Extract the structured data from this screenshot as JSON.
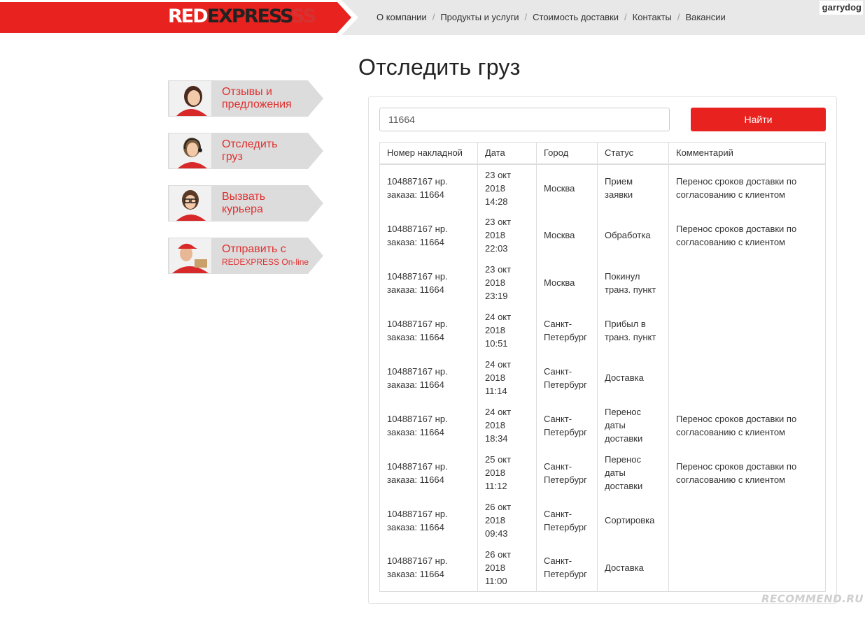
{
  "header": {
    "logo": {
      "red": "RED",
      "dark": "EXPRESS",
      "mark": "S"
    },
    "nav": [
      "О компании",
      "Продукты и услуги",
      "Стоимость доставки",
      "Контакты",
      "Вакансии"
    ],
    "user": "garrydog"
  },
  "page_title": "Отследить груз",
  "sidebar": {
    "items": [
      {
        "line1": "Отзывы и",
        "line2": "предложения",
        "avatar": "woman-smiling-icon"
      },
      {
        "line1": "Отследить",
        "line2": "груз",
        "avatar": "operator-headset-icon"
      },
      {
        "line1": "Вызвать",
        "line2": "курьера",
        "avatar": "woman-glasses-icon"
      },
      {
        "line1": "Отправить с",
        "line2": "REDEXPRESS On-line",
        "avatar": "courier-cap-icon"
      }
    ]
  },
  "search": {
    "value": "11664",
    "button": "Найти"
  },
  "table": {
    "headers": [
      "Номер накладной",
      "Дата",
      "Город",
      "Статус",
      "Комментарий"
    ],
    "rows": [
      {
        "waybill": [
          "104887167 нр.",
          "заказа: 11664"
        ],
        "date": [
          "23 окт",
          "2018",
          "14:28"
        ],
        "city": [
          "Москва"
        ],
        "status": [
          "Прием",
          "заявки"
        ],
        "comment": [
          "Перенос сроков доставки по",
          "согласованию с клиентом"
        ]
      },
      {
        "waybill": [
          "104887167 нр.",
          "заказа: 11664"
        ],
        "date": [
          "23 окт",
          "2018",
          "22:03"
        ],
        "city": [
          "Москва"
        ],
        "status": [
          "Обработка"
        ],
        "comment": [
          "Перенос сроков доставки по",
          "согласованию с клиентом"
        ]
      },
      {
        "waybill": [
          "104887167 нр.",
          "заказа: 11664"
        ],
        "date": [
          "23 окт",
          "2018",
          "23:19"
        ],
        "city": [
          "Москва"
        ],
        "status": [
          "Покинул",
          "транз. пункт"
        ],
        "comment": []
      },
      {
        "waybill": [
          "104887167 нр.",
          "заказа: 11664"
        ],
        "date": [
          "24 окт",
          "2018",
          "10:51"
        ],
        "city": [
          "Санкт-",
          "Петербург"
        ],
        "status": [
          "Прибыл в",
          "транз. пункт"
        ],
        "comment": []
      },
      {
        "waybill": [
          "104887167 нр.",
          "заказа: 11664"
        ],
        "date": [
          "24 окт",
          "2018",
          "11:14"
        ],
        "city": [
          "Санкт-",
          "Петербург"
        ],
        "status": [
          "Доставка"
        ],
        "comment": []
      },
      {
        "waybill": [
          "104887167 нр.",
          "заказа: 11664"
        ],
        "date": [
          "24 окт",
          "2018",
          "18:34"
        ],
        "city": [
          "Санкт-",
          "Петербург"
        ],
        "status": [
          "Перенос",
          "даты",
          "доставки"
        ],
        "comment": [
          "Перенос сроков доставки по",
          "согласованию с клиентом"
        ]
      },
      {
        "waybill": [
          "104887167 нр.",
          "заказа: 11664"
        ],
        "date": [
          "25 окт",
          "2018",
          "11:12"
        ],
        "city": [
          "Санкт-",
          "Петербург"
        ],
        "status": [
          "Перенос",
          "даты",
          "доставки"
        ],
        "comment": [
          "Перенос сроков доставки по",
          "согласованию с клиентом"
        ]
      },
      {
        "waybill": [
          "104887167 нр.",
          "заказа: 11664"
        ],
        "date": [
          "26 окт",
          "2018",
          "09:43"
        ],
        "city": [
          "Санкт-",
          "Петербург"
        ],
        "status": [
          "Сортировка"
        ],
        "comment": []
      },
      {
        "waybill": [
          "104887167 нр.",
          "заказа: 11664"
        ],
        "date": [
          "26 окт",
          "2018",
          "11:00"
        ],
        "city": [
          "Санкт-",
          "Петербург"
        ],
        "status": [
          "Доставка"
        ],
        "comment": []
      }
    ]
  },
  "watermark": "RECOMMEND.RU",
  "colors": {
    "brand_red": "#e8231f",
    "header_grey": "#e8e8e8",
    "sidebar_grey": "#dcdcdc"
  }
}
